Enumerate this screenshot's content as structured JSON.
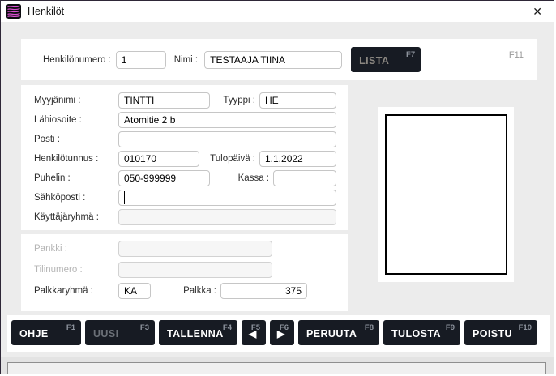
{
  "colors": {
    "dark_button_bg": "#171b23",
    "window_border": "#2e2737",
    "content_bg": "#ececec",
    "panel_bg": "#ffffff",
    "icon_pink": "#d94fd0",
    "disabled_button_text": "#6b7077"
  },
  "window": {
    "title": "Henkilöt",
    "close_glyph": "✕"
  },
  "header": {
    "henkilonumero": {
      "label": "Henkilönumero :",
      "value": "1"
    },
    "nimi": {
      "label": "Nimi :",
      "value": "TESTAAJA TIINA"
    },
    "lista": {
      "label": "LISTA",
      "fkey": "F7"
    },
    "f11": "F11"
  },
  "form": {
    "myyjanimi": {
      "label": "Myyjänimi :",
      "value": "TINTTI"
    },
    "tyyppi": {
      "label": "Tyyppi :",
      "value": "HE"
    },
    "lahiosoite": {
      "label": "Lähiosoite :",
      "value": "Atomitie 2 b"
    },
    "posti": {
      "label": "Posti :",
      "value": ""
    },
    "henkilotunnus": {
      "label": "Henkilötunnus :",
      "value": "010170"
    },
    "tulopaiva": {
      "label": "Tulopäivä :",
      "value": "1.1.2022"
    },
    "puhelin": {
      "label": "Puhelin :",
      "value": "050-999999"
    },
    "kassa": {
      "label": "Kassa :",
      "value": ""
    },
    "sahkoposti": {
      "label": "Sähköposti :",
      "value": ""
    },
    "kayttajaryhma": {
      "label": "Käyttäjäryhmä :",
      "value": ""
    }
  },
  "bank": {
    "pankki": {
      "label": "Pankki :",
      "value": ""
    },
    "tilinumero": {
      "label": "Tilinumero :",
      "value": ""
    },
    "palkkaryhma": {
      "label": "Palkkaryhmä :",
      "value": "KA"
    },
    "palkka": {
      "label": "Palkka :",
      "value": "375"
    }
  },
  "footer": {
    "buttons": [
      {
        "label": "OHJE",
        "fkey": "F1"
      },
      {
        "label": "UUSI",
        "fkey": "F3"
      },
      {
        "label": "TALLENNA",
        "fkey": "F4"
      },
      {
        "icon": "arrow-left-icon",
        "glyph": "◀",
        "fkey": "F5"
      },
      {
        "icon": "arrow-right-icon",
        "glyph": "▶",
        "fkey": "F6"
      },
      {
        "label": "PERUUTA",
        "fkey": "F8"
      },
      {
        "label": "TULOSTA",
        "fkey": "F9"
      },
      {
        "label": "POISTU",
        "fkey": "F10"
      }
    ]
  }
}
